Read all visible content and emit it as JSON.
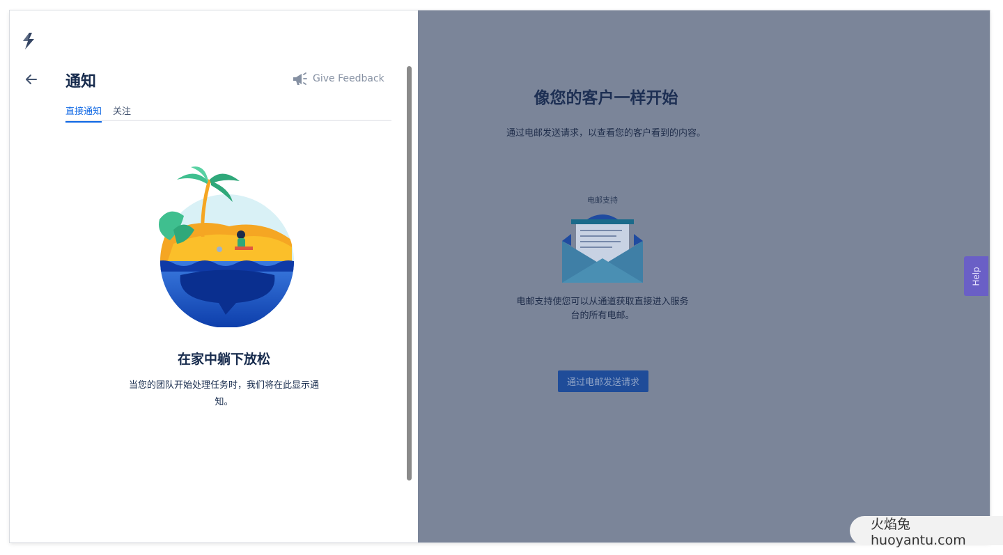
{
  "panel": {
    "title": "通知",
    "feedback_label": "Give Feedback",
    "tabs": [
      {
        "label": "直接通知",
        "active": true
      },
      {
        "label": "关注",
        "active": false
      }
    ],
    "empty_state": {
      "title": "在家中躺下放松",
      "description": "当您的团队开始处理任务时，我们将在此显示通知。"
    }
  },
  "backdrop": {
    "title": "像您的客户一样开始",
    "subtitle": "通过电邮发送请求，以查看您的客户看到的内容。",
    "card_label": "电邮支持",
    "description": "电邮支持使您可以从通道获取直接进入服务台的所有电邮。",
    "button_label": "通过电邮发送请求",
    "help_label": "Help"
  },
  "watermark": {
    "text": "火焰兔 huoyantu.com"
  },
  "colors": {
    "accent": "#0c66e4",
    "backdrop": "#7b8599",
    "heading": "#172b4d",
    "help": "#6a5fc6",
    "button": "#1f4c99"
  },
  "icons": [
    "lightning-logo-icon",
    "arrow-left-icon",
    "megaphone-icon",
    "envelope-icon",
    "island-illustration"
  ]
}
